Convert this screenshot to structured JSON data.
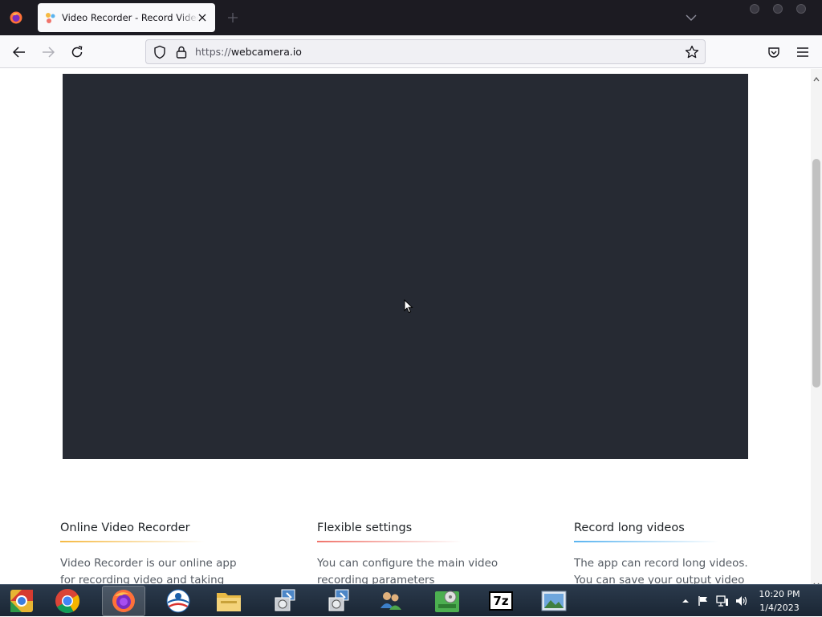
{
  "browser": {
    "tab": {
      "title": "Video Recorder - Record Video o"
    },
    "url": {
      "scheme": "https://",
      "host": "webcamera.io"
    }
  },
  "page": {
    "features": [
      {
        "title": "Online Video Recorder",
        "accent": "#f5b942",
        "text": "Video Recorder is our online app for recording video and taking"
      },
      {
        "title": "Flexible settings",
        "accent": "#f0746b",
        "text": "You can configure the main video recording parameters"
      },
      {
        "title": "Record long videos",
        "accent": "#5ab4f0",
        "text": "The app can record long videos. You can save your output video"
      }
    ]
  },
  "taskbar": {
    "apps": [
      {
        "name": "Chrome Canary / Chromium",
        "icon": "chromium-icon"
      },
      {
        "name": "Google Chrome",
        "icon": "chrome-icon"
      },
      {
        "name": "Firefox",
        "icon": "firefox-icon",
        "active": true
      },
      {
        "name": "Outlook",
        "icon": "outlook-icon"
      },
      {
        "name": "File Explorer",
        "icon": "folder-icon"
      },
      {
        "name": "Setup",
        "icon": "installer-icon"
      },
      {
        "name": "Setup 2",
        "icon": "installer-icon"
      },
      {
        "name": "Network Users",
        "icon": "users-icon"
      },
      {
        "name": "Disk Tool",
        "icon": "disk-icon"
      },
      {
        "name": "7-Zip",
        "icon": "7zip-icon",
        "label": "7z"
      },
      {
        "name": "Image Viewer",
        "icon": "picture-icon"
      }
    ],
    "clock": {
      "time": "10:20 PM",
      "date": "1/4/2023"
    }
  }
}
